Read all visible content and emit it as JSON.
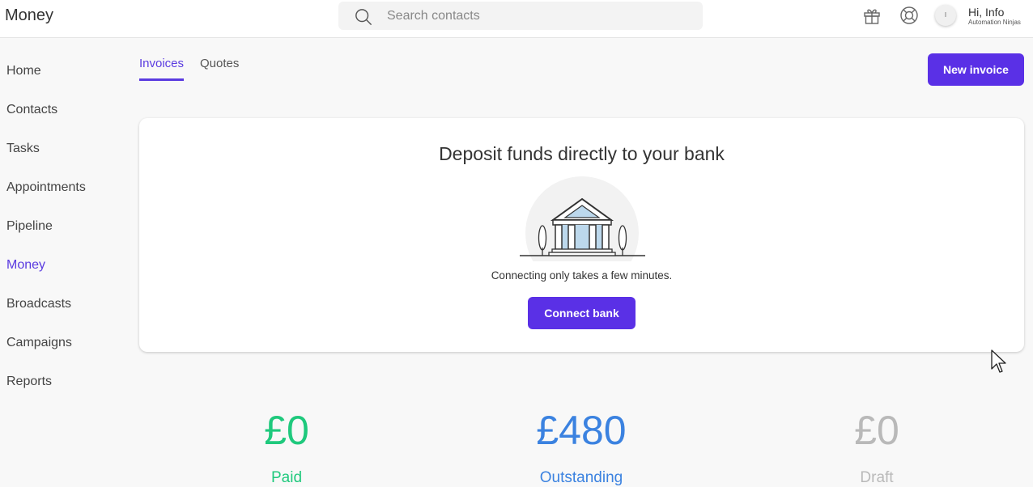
{
  "app": {
    "title": "Money"
  },
  "search": {
    "placeholder": "Search contacts"
  },
  "user": {
    "greeting": "Hi, Info",
    "company": "Automation Ninjas",
    "avatar_initial": "I"
  },
  "sidebar": {
    "items": [
      {
        "label": "Home"
      },
      {
        "label": "Contacts"
      },
      {
        "label": "Tasks"
      },
      {
        "label": "Appointments"
      },
      {
        "label": "Pipeline"
      },
      {
        "label": "Money"
      },
      {
        "label": "Broadcasts"
      },
      {
        "label": "Campaigns"
      },
      {
        "label": "Reports"
      }
    ],
    "active": "Money"
  },
  "tabs": [
    {
      "label": "Invoices"
    },
    {
      "label": "Quotes"
    }
  ],
  "toolbar": {
    "new_invoice_label": "New invoice"
  },
  "bank_card": {
    "title": "Deposit funds directly to your bank",
    "subtitle": "Connecting only takes a few minutes.",
    "connect_label": "Connect bank"
  },
  "stats": {
    "paid": {
      "value": "£0",
      "label": "Paid"
    },
    "outstanding": {
      "value": "£480",
      "label": "Outstanding"
    },
    "draft": {
      "value": "£0",
      "label": "Draft"
    }
  },
  "colors": {
    "accent": "#5a30e6",
    "paid": "#1fc97d",
    "outstanding": "#3b82e0",
    "draft": "#b9b9b9"
  },
  "icons": [
    "search-icon",
    "gift-icon",
    "help-icon",
    "bank-icon",
    "cursor-icon"
  ]
}
